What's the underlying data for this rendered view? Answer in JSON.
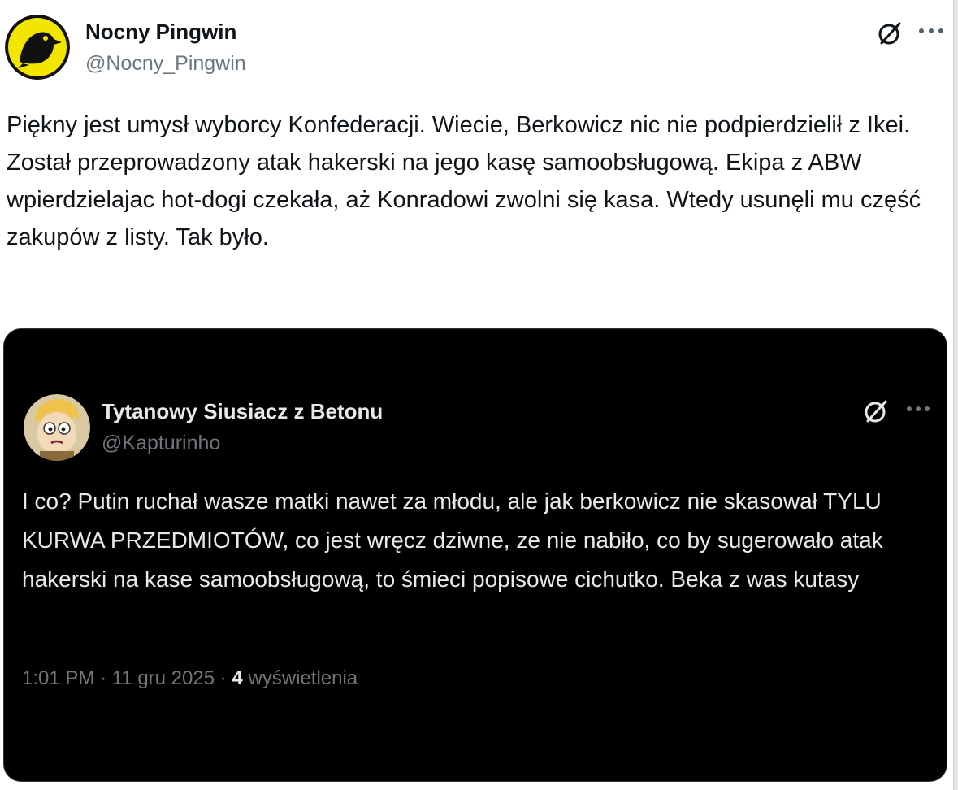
{
  "post": {
    "author_name": "Nocny Pingwin",
    "author_handle": "@Nocny_Pingwin",
    "grok_icon": "grok-slash-circle-icon",
    "more_icon": "more-dots-icon",
    "text": "Piękny jest umysł wyborcy Konfederacji. Wiecie, Berkowicz nic nie podpierdzielił z Ikei. Został przeprowadzony atak hakerski na jego kasę samoobsługową. Ekipa z ABW wpierdzielajac hot-dogi czekała, aż Konradowi zwolni się kasa. Wtedy usunęli mu część zakupów z listy. Tak było."
  },
  "quote": {
    "author_name": "Tytanowy Siusiacz z Betonu",
    "author_handle": "@Kapturinho",
    "grok_icon": "grok-slash-circle-icon",
    "more_icon": "more-dots-icon",
    "text": "I co? Putin ruchał wasze matki nawet za młodu, ale jak berkowicz nie skasował TYLU KURWA PRZEDMIOTÓW, co jest wręcz dziwne, ze nie nabiło, co by sugerowało atak hakerski na kase samoobsługową, to śmieci popisowe cichutko. Beka z was kutasy",
    "time": "1:01 PM",
    "separator": "·",
    "date": "11 gru 2025",
    "views_count": "4",
    "views_label": "wyświetlenia"
  },
  "colors": {
    "outer_bg": "#ffffff",
    "quote_bg": "#000000",
    "avatar_yellow": "#f2e600",
    "muted_text": "#71767b"
  }
}
